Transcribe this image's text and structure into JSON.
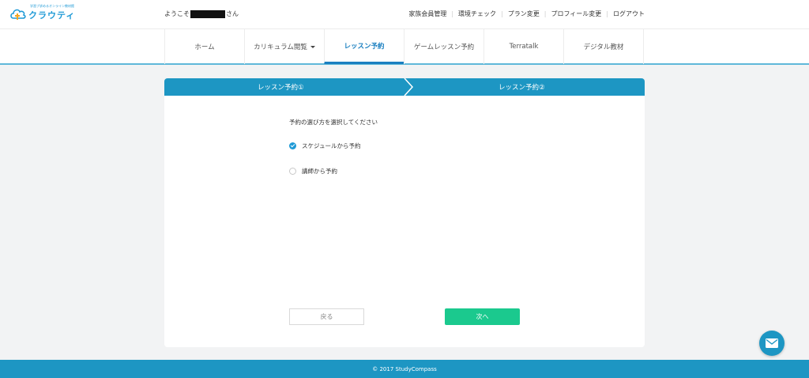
{
  "brand": {
    "tagline": "学習プ求めるオンライン教材館",
    "name": "クラウティ",
    "color": "#1f9ad6"
  },
  "header": {
    "welcome_prefix": "ようこそ",
    "welcome_suffix": "さん",
    "links": [
      "家族会員管理",
      "環境チェック",
      "プラン変更",
      "プロフィール変更",
      "ログアウト"
    ]
  },
  "nav": {
    "tabs": [
      "ホーム",
      "カリキュラム閲覧",
      "レッスン予約",
      "ゲームレッスン予約",
      "Terratalk",
      "デジタル教材"
    ],
    "active_index": 2,
    "active_color": "#1a7fc0"
  },
  "steps": [
    "レッスン予約①",
    "レッスン予約②"
  ],
  "form": {
    "prompt": "予約の選び方を選択してください",
    "options": [
      {
        "label": "スケジュールから予約",
        "selected": true
      },
      {
        "label": "講師から予約",
        "selected": false
      }
    ],
    "back_label": "戻る",
    "next_label": "次へ",
    "next_color": "#1bc98e"
  },
  "footer": {
    "copyright": "© 2017 StudyCompass",
    "color": "#1d96c3"
  },
  "floating": {
    "icon": "mail-icon"
  }
}
